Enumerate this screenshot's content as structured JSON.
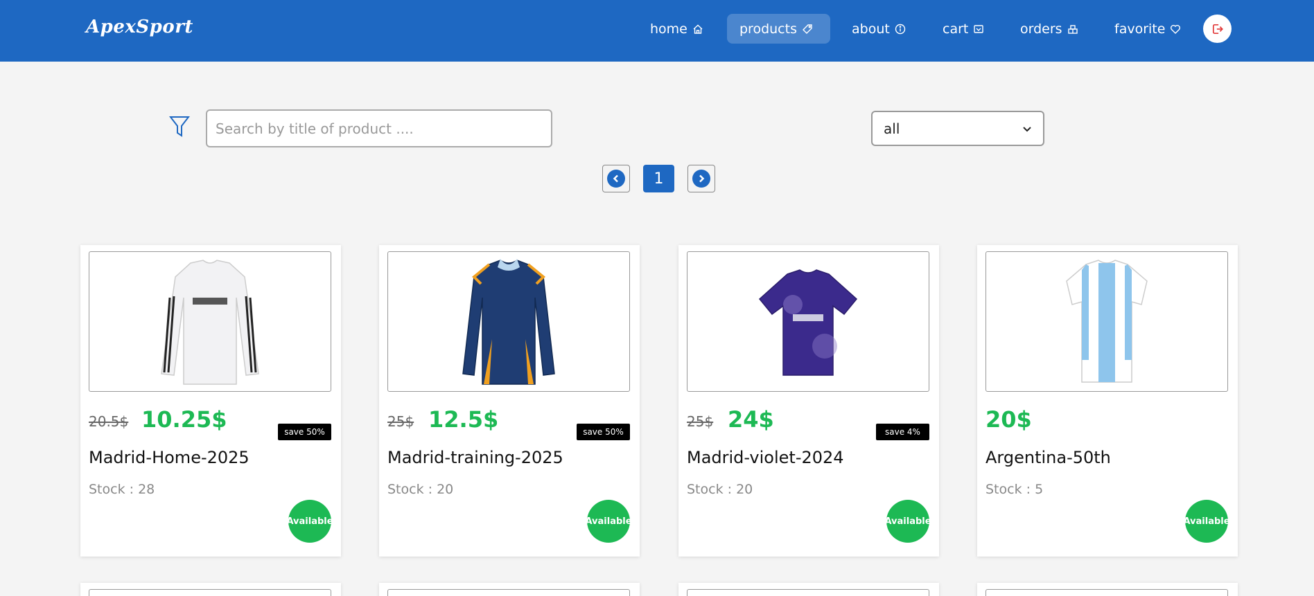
{
  "nav": {
    "brand": "ApexSport",
    "items": [
      {
        "label": "home",
        "icon": "home-icon"
      },
      {
        "label": "products",
        "icon": "tag-icon",
        "active": true
      },
      {
        "label": "about",
        "icon": "info-icon"
      },
      {
        "label": "cart",
        "icon": "cart-icon"
      },
      {
        "label": "orders",
        "icon": "orders-icon"
      },
      {
        "label": "favorite",
        "icon": "heart-icon"
      }
    ],
    "logout_icon": "logout-icon"
  },
  "controls": {
    "filter_icon": "filter-icon",
    "search_placeholder": "Search by title of product ....",
    "search_value": "",
    "category_selected": "all"
  },
  "pagination": {
    "current_page": "1",
    "prev_icon": "chevron-left-icon",
    "next_icon": "chevron-right-icon"
  },
  "products": [
    {
      "title": "Madrid-Home-2025",
      "old_price": "20.5$",
      "price": "10.25$",
      "save": "save 50%",
      "stock": "Stock : 28",
      "status": "Available",
      "shirt_color": "#f2f2f4",
      "accent": "#222222"
    },
    {
      "title": "Madrid-training-2025",
      "old_price": "25$",
      "price": "12.5$",
      "save": "save 50%",
      "stock": "Stock : 20",
      "status": "Available",
      "shirt_color": "#1f3d73",
      "accent": "#f0a020"
    },
    {
      "title": "Madrid-violet-2024",
      "old_price": "25$",
      "price": "24$",
      "save": "save 4%",
      "stock": "Stock : 20",
      "status": "Available",
      "shirt_color": "#3b2a8c",
      "accent": "#8b7ac8"
    },
    {
      "title": "Argentina-50th",
      "old_price": "",
      "price": "20$",
      "save": "",
      "stock": "Stock : 5",
      "status": "Available",
      "shirt_color": "#ffffff",
      "accent": "#8ec5ec"
    }
  ],
  "colors": {
    "primary": "#1e68c2",
    "price_green": "#1db954",
    "badge_black": "#000000"
  }
}
